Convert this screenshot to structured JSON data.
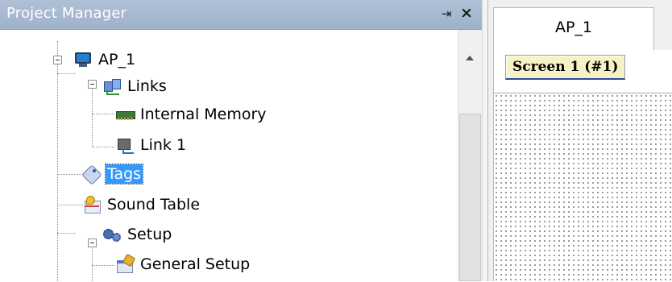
{
  "project_manager": {
    "title": "Project Manager",
    "pin_glyph": "⇥",
    "close_glyph": "×",
    "tree": {
      "root": {
        "label": "AP_1",
        "icon": "monitor-icon"
      },
      "links": {
        "label": "Links",
        "icon": "links-icon"
      },
      "internal_memory": {
        "label": "Internal Memory",
        "icon": "memory-icon"
      },
      "link1": {
        "label": "Link 1",
        "icon": "link-device-icon"
      },
      "tags": {
        "label": "Tags",
        "icon": "tags-icon",
        "selected": true
      },
      "sound_table": {
        "label": "Sound Table",
        "icon": "sound-table-icon"
      },
      "setup": {
        "label": "Setup",
        "icon": "setup-gears-icon"
      },
      "general_setup": {
        "label": "General Setup",
        "icon": "general-setup-icon"
      }
    }
  },
  "editor": {
    "document_tab": "AP_1",
    "screen_tab": "Screen 1 (#1)"
  },
  "colors": {
    "titlebar": "#afc0d6",
    "selection": "#3399ff",
    "screen_tab_bg": "#f7f2c6"
  }
}
